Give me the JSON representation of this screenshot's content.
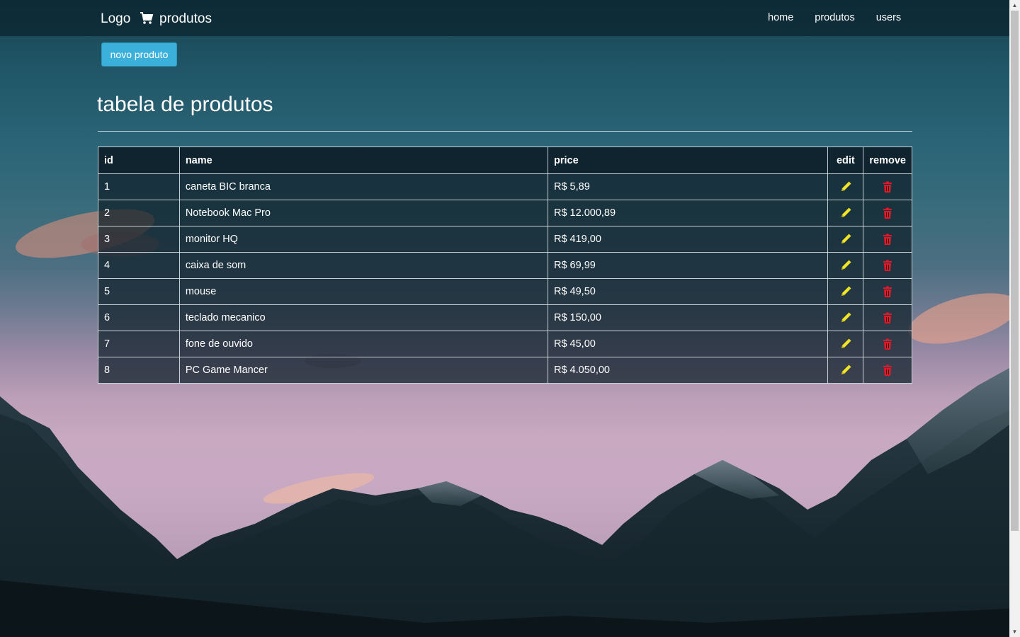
{
  "navbar": {
    "logo": "Logo",
    "brand_label": "produtos",
    "cart_icon": "cart-icon",
    "links": [
      {
        "label": "home"
      },
      {
        "label": "produtos"
      },
      {
        "label": "users"
      }
    ]
  },
  "actions": {
    "new_product_label": "novo produto"
  },
  "page": {
    "title": "tabela de produtos"
  },
  "table": {
    "headers": {
      "id": "id",
      "name": "name",
      "price": "price",
      "edit": "edit",
      "remove": "remove"
    },
    "edit_icon": "pencil-icon",
    "remove_icon": "trash-icon",
    "rows": [
      {
        "id": "1",
        "name": "caneta BIC branca",
        "price": "R$ 5,89"
      },
      {
        "id": "2",
        "name": "Notebook Mac Pro",
        "price": "R$ 12.000,89"
      },
      {
        "id": "3",
        "name": "monitor HQ",
        "price": "R$ 419,00"
      },
      {
        "id": "4",
        "name": "caixa de som",
        "price": "R$ 69,99"
      },
      {
        "id": "5",
        "name": "mouse",
        "price": "R$ 49,50"
      },
      {
        "id": "6",
        "name": "teclado mecanico",
        "price": "R$ 150,00"
      },
      {
        "id": "7",
        "name": "fone de ouvido",
        "price": "R$ 45,00"
      },
      {
        "id": "8",
        "name": "PC Game Mancer",
        "price": "R$ 4.050,00"
      }
    ]
  },
  "colors": {
    "button": "#3ab0db",
    "edit_icon": "#f3e626",
    "remove_icon": "#e0192a"
  }
}
